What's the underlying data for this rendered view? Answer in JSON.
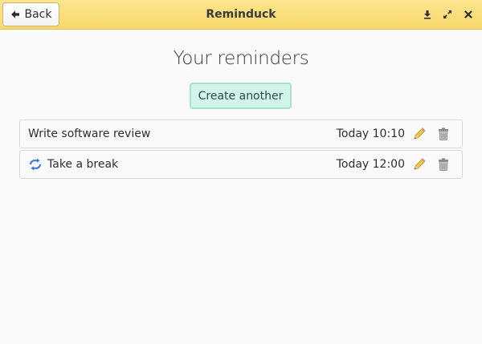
{
  "header": {
    "title": "Reminduck",
    "back_label": "Back",
    "back_icon": "arrow-left-icon",
    "controls": [
      "download-icon",
      "maximize-icon",
      "close-icon"
    ],
    "bg_color": "#f9dc72"
  },
  "main": {
    "heading": "Your reminders",
    "create_label": "Create another",
    "accent_color": "#d2f4ea"
  },
  "reminders": [
    {
      "title": "Write software review",
      "time": "Today 10:10",
      "repeating": false
    },
    {
      "title": "Take a break",
      "time": "Today 12:00",
      "repeating": true
    }
  ]
}
